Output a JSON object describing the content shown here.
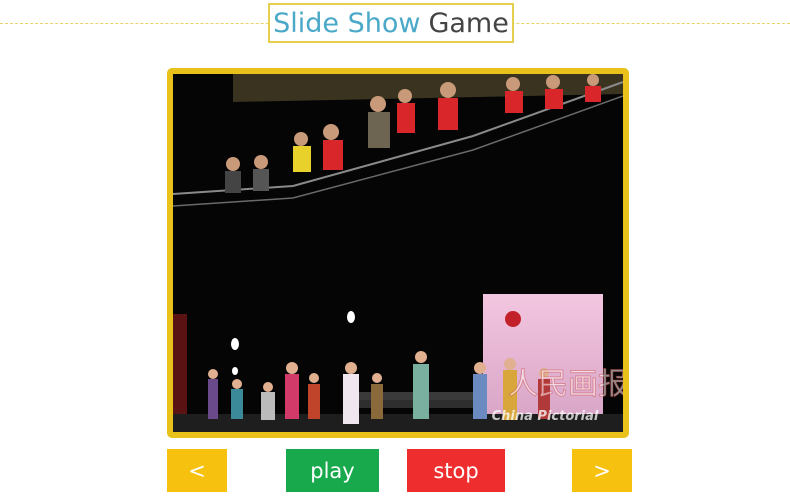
{
  "title": {
    "part1": "Slide Show",
    "part2": "Game"
  },
  "slide": {
    "watermark_brand": "China Pictorial",
    "watermark_chinese": "人民画报"
  },
  "controls": {
    "prev_label": "<",
    "play_label": "play",
    "stop_label": "stop",
    "next_label": ">"
  },
  "colors": {
    "title_accent": "#4aa8c8",
    "frame": "#e8c21a",
    "nav_button": "#f7c10f",
    "play_button": "#17a94b",
    "stop_button": "#ee2e2e"
  }
}
